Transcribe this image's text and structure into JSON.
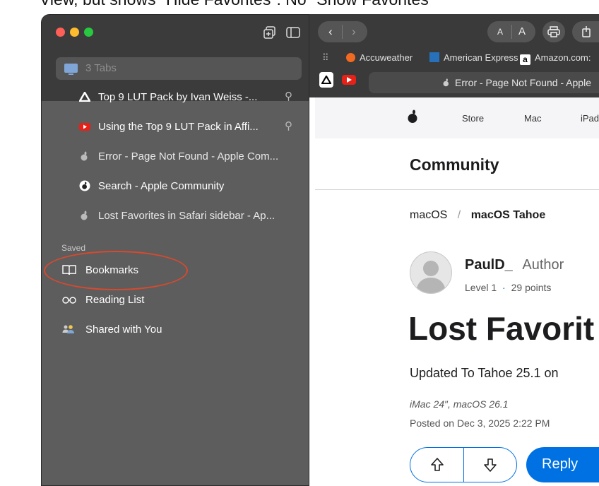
{
  "caption": "View, but shows \"Hide Favorites\". No \"Show Favorites\"",
  "sidebar": {
    "tab_group_label": "3 Tabs",
    "tabs": [
      {
        "title": "Top 9 LUT Pack by Ivan Weiss -...",
        "pinned": true,
        "icon": "affinity-icon"
      },
      {
        "title": "Using the Top 9 LUT Pack in Affi...",
        "pinned": true,
        "icon": "youtube-icon"
      },
      {
        "title": "Error - Page Not Found - Apple Com...",
        "pinned": false,
        "icon": "apple-icon"
      },
      {
        "title": "Search - Apple Community",
        "pinned": false,
        "icon": "apple-community-icon"
      },
      {
        "title": "Lost Favorites in Safari sidebar - Ap...",
        "pinned": false,
        "icon": "apple-icon"
      }
    ],
    "section_label": "Saved",
    "saved_items": [
      {
        "label": "Bookmarks",
        "icon": "book-icon"
      },
      {
        "label": "Reading List",
        "icon": "glasses-icon"
      },
      {
        "label": "Shared with You",
        "icon": "people-icon"
      }
    ],
    "highlight_color": "#d9492e"
  },
  "toolbar": {
    "text_small": "A",
    "text_large": "A",
    "favorites_bar": [
      "Accuweather",
      "American Express",
      "Amazon.com:"
    ],
    "address_text": "Error - Page Not Found - Apple"
  },
  "page": {
    "nav": [
      "Store",
      "Mac",
      "iPad"
    ],
    "community": "Community",
    "breadcrumb_root": "macOS",
    "breadcrumb_sep": "/",
    "breadcrumb_current": "macOS Tahoe",
    "author_name": "PaulD_",
    "author_role": "Author",
    "author_level": "Level 1",
    "author_sep": "·",
    "author_points": "29 points",
    "title": "Lost Favorit",
    "updated": "Updated To Tahoe 25.1 on",
    "device": "iMac 24″, macOS 26.1",
    "posted": "Posted on Dec 3, 2025 2:22 PM",
    "reply": "Reply",
    "accent": "#0071e3"
  }
}
